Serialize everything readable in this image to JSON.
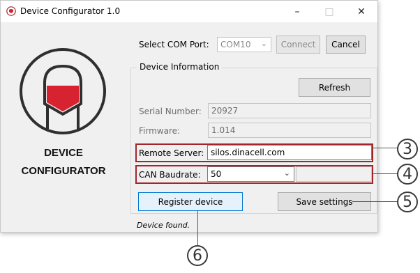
{
  "window": {
    "title": "Device Configurator 1.0",
    "minimize_glyph": "–",
    "maximize_glyph": "□",
    "close_glyph": "✕"
  },
  "brand": {
    "line1": "DEVICE",
    "line2": "CONFIGURATOR"
  },
  "com_port": {
    "label": "Select COM Port:",
    "value": "COM10",
    "connect_label": "Connect",
    "cancel_label": "Cancel"
  },
  "device_info": {
    "group_title": "Device Information",
    "refresh_label": "Refresh",
    "serial_label": "Serial Number:",
    "serial_value": "20927",
    "firmware_label": "Firmware:",
    "firmware_value": "1.014",
    "remote_label": "Remote Server:",
    "remote_value": "silos.dinacell.com",
    "can_label": "CAN Baudrate:",
    "can_value": "50"
  },
  "actions": {
    "register_label": "Register device",
    "save_label": "Save settings"
  },
  "status": {
    "text": "Device found."
  },
  "callouts": [
    "3",
    "4",
    "5",
    "6"
  ],
  "colors": {
    "highlight": "#a3262b",
    "brand_red": "#d7232f",
    "focus_blue": "#0078d7"
  }
}
